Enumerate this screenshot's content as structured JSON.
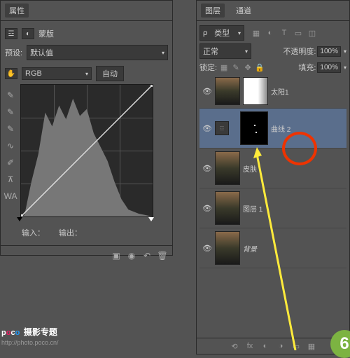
{
  "properties": {
    "tab_label": "属性",
    "mask_label": "蒙版",
    "preset_label": "预设:",
    "preset_value": "默认值",
    "channel_value": "RGB",
    "auto_label": "自动",
    "input_label": "输入：",
    "output_label": "输出："
  },
  "layers": {
    "tab1": "图层",
    "tab2": "通道",
    "type_label": "类型",
    "blend_mode": "正常",
    "opacity_label": "不透明度:",
    "opacity_value": "100%",
    "lock_label": "锁定:",
    "fill_label": "填充:",
    "fill_value": "100%",
    "items": [
      {
        "name": "太阳1",
        "selected": false,
        "thumb": "forest",
        "has_mask": true,
        "mask": "white"
      },
      {
        "name": "曲线 2",
        "selected": true,
        "thumb": "adj",
        "has_mask": true,
        "mask": "black"
      },
      {
        "name": "皮肤",
        "selected": false,
        "thumb": "forest",
        "has_mask": false
      },
      {
        "name": "图层 1",
        "selected": false,
        "thumb": "forest",
        "has_mask": false
      },
      {
        "name": "背景",
        "selected": false,
        "thumb": "forest",
        "has_mask": false,
        "italic": true
      }
    ]
  },
  "footer": {
    "fx": "fx"
  },
  "watermark": {
    "brand_p": "p",
    "brand_o1": "o",
    "brand_c": "c",
    "brand_o2": "o",
    "subtitle": "摄影专题",
    "url": "http://photo.poco.cn/"
  },
  "badge": "6"
}
